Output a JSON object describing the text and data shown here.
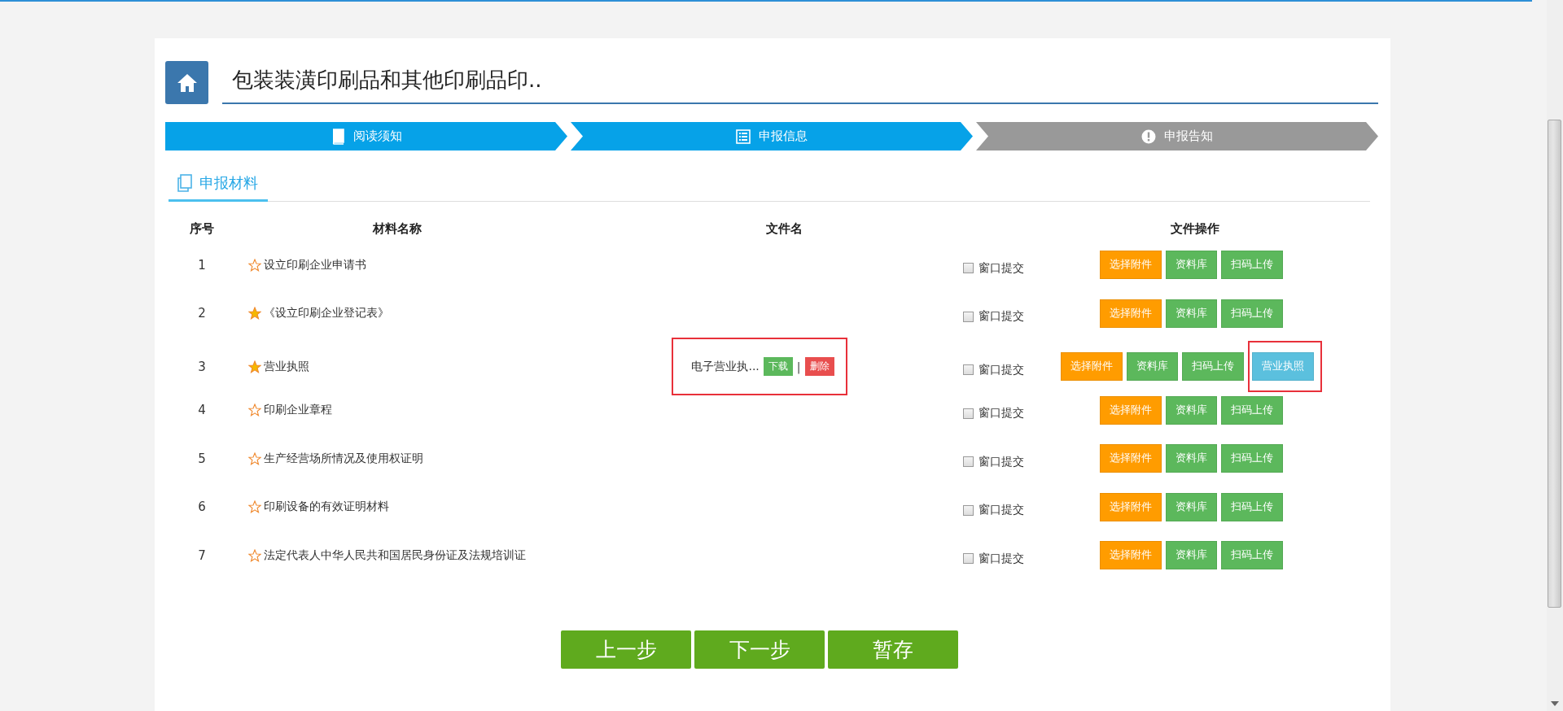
{
  "page_title": "包装装潢印刷品和其他印刷品印..",
  "steps": [
    {
      "label": "阅读须知",
      "active": true
    },
    {
      "label": "申报信息",
      "active": true
    },
    {
      "label": "申报告知",
      "active": false
    }
  ],
  "section_tab": {
    "label": "申报材料",
    "selected": true
  },
  "table": {
    "columns": [
      "序号",
      "材料名称",
      "文件名",
      "文件操作"
    ],
    "rows": [
      {
        "index": "1",
        "name": "设立印刷企业申请书",
        "starred": false,
        "window_submit": {
          "label": "窗口提交",
          "checked": false
        },
        "buttons": [
          {
            "label": "选择附件",
            "kind": "attach"
          },
          {
            "label": "资料库",
            "kind": "library"
          },
          {
            "label": "扫码上传",
            "kind": "scan"
          }
        ]
      },
      {
        "index": "2",
        "name": "《设立印刷企业登记表》",
        "starred": true,
        "window_submit": {
          "label": "窗口提交",
          "checked": false
        },
        "buttons": [
          {
            "label": "选择附件",
            "kind": "attach"
          },
          {
            "label": "资料库",
            "kind": "library"
          },
          {
            "label": "扫码上传",
            "kind": "scan"
          }
        ]
      },
      {
        "index": "3",
        "name": "营业执照",
        "starred": true,
        "file": {
          "name": "电子营业执...",
          "highlighted": true,
          "separator": "|",
          "actions": [
            {
              "label": "下载",
              "kind": "download"
            },
            {
              "label": "删除",
              "kind": "delete"
            }
          ]
        },
        "window_submit": {
          "label": "窗口提交",
          "checked": false
        },
        "buttons": [
          {
            "label": "选择附件",
            "kind": "attach"
          },
          {
            "label": "资料库",
            "kind": "library"
          },
          {
            "label": "扫码上传",
            "kind": "scan"
          },
          {
            "label": "营业执照",
            "kind": "license",
            "highlighted": true
          }
        ]
      },
      {
        "index": "4",
        "name": "印刷企业章程",
        "starred": false,
        "window_submit": {
          "label": "窗口提交",
          "checked": false
        },
        "buttons": [
          {
            "label": "选择附件",
            "kind": "attach"
          },
          {
            "label": "资料库",
            "kind": "library"
          },
          {
            "label": "扫码上传",
            "kind": "scan"
          }
        ]
      },
      {
        "index": "5",
        "name": "生产经营场所情况及使用权证明",
        "starred": false,
        "window_submit": {
          "label": "窗口提交",
          "checked": false
        },
        "buttons": [
          {
            "label": "选择附件",
            "kind": "attach"
          },
          {
            "label": "资料库",
            "kind": "library"
          },
          {
            "label": "扫码上传",
            "kind": "scan"
          }
        ]
      },
      {
        "index": "6",
        "name": "印刷设备的有效证明材料",
        "starred": false,
        "window_submit": {
          "label": "窗口提交",
          "checked": false
        },
        "buttons": [
          {
            "label": "选择附件",
            "kind": "attach"
          },
          {
            "label": "资料库",
            "kind": "library"
          },
          {
            "label": "扫码上传",
            "kind": "scan"
          }
        ]
      },
      {
        "index": "7",
        "name": "法定代表人中华人民共和国居民身份证及法规培训证",
        "starred": false,
        "window_submit": {
          "label": "窗口提交",
          "checked": false
        },
        "buttons": [
          {
            "label": "选择附件",
            "kind": "attach"
          },
          {
            "label": "资料库",
            "kind": "library"
          },
          {
            "label": "扫码上传",
            "kind": "scan"
          }
        ]
      }
    ]
  },
  "footer_buttons": [
    "上一步",
    "下一步",
    "暂存"
  ]
}
